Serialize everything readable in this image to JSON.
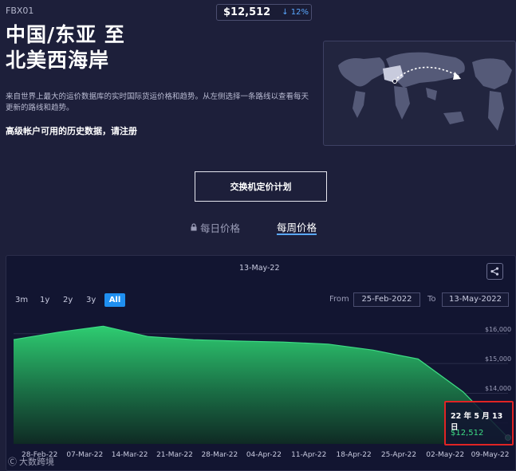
{
  "header": {
    "route_code": "FBX01",
    "current_price": "$12,512",
    "price_change": "12%",
    "change_arrow": "↓",
    "title_line1": "中国/东亚 至",
    "title_line2": "北美西海岸",
    "description": "来自世界上最大的运价数据库的实时国际货运价格和趋势。从左侧选择一条路线以查看每天更新的路线和趋势。",
    "premium_note": "高级帐户可用的历史数据，请注册"
  },
  "cta": {
    "label": "交换机定价计划"
  },
  "tabs": [
    {
      "label": "每日价格",
      "icon": "lock-icon",
      "active": false
    },
    {
      "label": "每周价格",
      "active": true
    }
  ],
  "chart_toolbar": {
    "top_date": "13-May-22",
    "ranges": [
      "3m",
      "1y",
      "2y",
      "3y",
      "All"
    ],
    "active_range": "All",
    "from_label": "From",
    "from_value": "25-Feb-2022",
    "to_label": "To",
    "to_value": "13-May-2022"
  },
  "tooltip": {
    "date": "22 年 5 月 13 日",
    "value": "$12,512"
  },
  "watermark": "大数跨境",
  "colors": {
    "background": "#1d1f3a",
    "chart_bg": "#121531",
    "accent": "#1f8ff0",
    "series": "#2ecc71",
    "highlight": "#e02424"
  },
  "chart_data": {
    "type": "area",
    "title": "",
    "x": [
      "28-Feb-22",
      "07-Mar-22",
      "14-Mar-22",
      "21-Mar-22",
      "28-Mar-22",
      "04-Apr-22",
      "11-Apr-22",
      "18-Apr-22",
      "25-Apr-22",
      "02-May-22",
      "09-May-22",
      "13-May-22"
    ],
    "series": [
      {
        "values": [
          15800,
          16050,
          16250,
          15900,
          15800,
          15750,
          15720,
          15650,
          15450,
          15150,
          14050,
          12512
        ]
      }
    ],
    "x_ticks": [
      "28-Feb-22",
      "07-Mar-22",
      "14-Mar-22",
      "21-Mar-22",
      "28-Mar-22",
      "04-Apr-22",
      "11-Apr-22",
      "18-Apr-22",
      "25-Apr-22",
      "02-May-22",
      "09-May-22"
    ],
    "y_ticks": [
      "$16,000",
      "$15,000",
      "$14,000"
    ],
    "ylim": [
      12300,
      16500
    ],
    "grid": true,
    "legend": "none"
  }
}
